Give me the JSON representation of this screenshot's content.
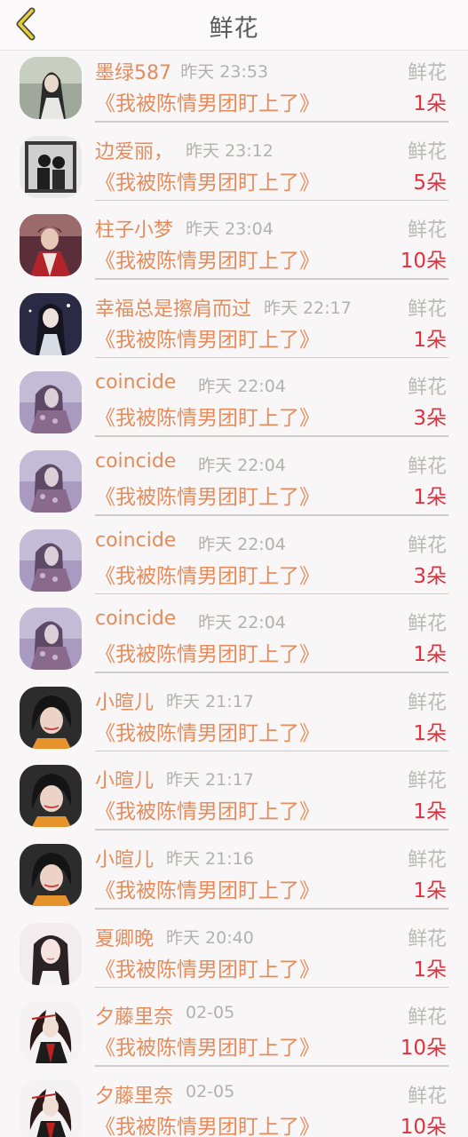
{
  "header": {
    "title": "鲜花"
  },
  "rows": [
    {
      "name": "墨绿587",
      "time": "昨天 23:53",
      "gift": "鲜花",
      "book": "《我被陈情男团盯上了》",
      "count": "1朵",
      "avatar": "avatar-1"
    },
    {
      "name": "边爱丽，",
      "time": "昨天 23:12",
      "gift": "鲜花",
      "book": "《我被陈情男团盯上了》",
      "count": "5朵",
      "avatar": "avatar-2"
    },
    {
      "name": "柱子小梦",
      "time": "昨天 23:04",
      "gift": "鲜花",
      "book": "《我被陈情男团盯上了》",
      "count": "10朵",
      "avatar": "avatar-3"
    },
    {
      "name": "幸福总是擦肩而过",
      "time": "昨天 22:17",
      "gift": "鲜花",
      "book": "《我被陈情男团盯上了》",
      "count": "1朵",
      "avatar": "avatar-4"
    },
    {
      "name": "coincide",
      "time": "昨天 22:04",
      "gift": "鲜花",
      "book": "《我被陈情男团盯上了》",
      "count": "3朵",
      "avatar": "avatar-5"
    },
    {
      "name": "coincide",
      "time": "昨天 22:04",
      "gift": "鲜花",
      "book": "《我被陈情男团盯上了》",
      "count": "1朵",
      "avatar": "avatar-5"
    },
    {
      "name": "coincide",
      "time": "昨天 22:04",
      "gift": "鲜花",
      "book": "《我被陈情男团盯上了》",
      "count": "3朵",
      "avatar": "avatar-5"
    },
    {
      "name": "coincide",
      "time": "昨天 22:04",
      "gift": "鲜花",
      "book": "《我被陈情男团盯上了》",
      "count": "1朵",
      "avatar": "avatar-5"
    },
    {
      "name": "小暄儿",
      "time": "昨天 21:17",
      "gift": "鲜花",
      "book": "《我被陈情男团盯上了》",
      "count": "1朵",
      "avatar": "avatar-6"
    },
    {
      "name": "小暄儿",
      "time": "昨天 21:17",
      "gift": "鲜花",
      "book": "《我被陈情男团盯上了》",
      "count": "1朵",
      "avatar": "avatar-6"
    },
    {
      "name": "小暄儿",
      "time": "昨天 21:16",
      "gift": "鲜花",
      "book": "《我被陈情男团盯上了》",
      "count": "1朵",
      "avatar": "avatar-6"
    },
    {
      "name": "夏卿晚",
      "time": "昨天 20:40",
      "gift": "鲜花",
      "book": "《我被陈情男团盯上了》",
      "count": "1朵",
      "avatar": "avatar-7"
    },
    {
      "name": "夕藤里奈",
      "time": "02-05",
      "gift": "鲜花",
      "book": "《我被陈情男团盯上了》",
      "count": "10朵",
      "avatar": "avatar-8"
    },
    {
      "name": "夕藤里奈",
      "time": "02-05",
      "gift": "鲜花",
      "book": "《我被陈情男团盯上了》",
      "count": "10朵",
      "avatar": "avatar-8"
    }
  ]
}
